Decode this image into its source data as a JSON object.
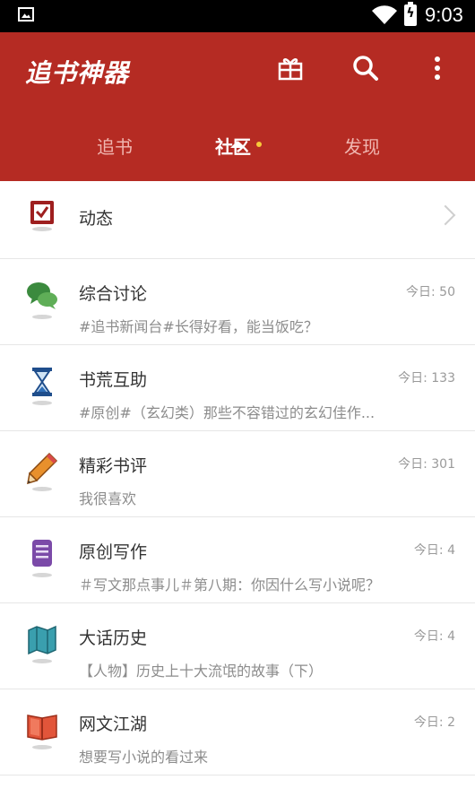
{
  "statusbar": {
    "time": "9:03"
  },
  "header": {
    "app_title": "追书神器",
    "tabs": [
      {
        "label": "追书"
      },
      {
        "label": "社区"
      },
      {
        "label": "发现"
      }
    ]
  },
  "list": {
    "dynamic": {
      "title": "动态"
    },
    "forums": [
      {
        "title": "综合讨论",
        "count": "今日: 50",
        "preview": "#追书新闻台#长得好看，能当饭吃？",
        "icon": "chat-bubbles-icon"
      },
      {
        "title": "书荒互助",
        "count": "今日: 133",
        "preview": "#原创#（玄幻类）那些不容错过的玄幻佳作...",
        "icon": "hourglass-icon"
      },
      {
        "title": "精彩书评",
        "count": "今日: 301",
        "preview": "我很喜欢",
        "icon": "pencil-icon"
      },
      {
        "title": "原创写作",
        "count": "今日: 4",
        "preview": "＃写文那点事儿＃第八期：你因什么写小说呢？",
        "icon": "notepad-icon"
      },
      {
        "title": "大话历史",
        "count": "今日: 4",
        "preview": "【人物】历史上十大流氓的故事（下）",
        "icon": "map-icon"
      },
      {
        "title": "网文江湖",
        "count": "今日: 2",
        "preview": "想要写小说的看过来",
        "icon": "open-book-icon"
      }
    ]
  },
  "colors": {
    "appbar": "#b52b23",
    "tab_dot": "#f7c93a"
  }
}
